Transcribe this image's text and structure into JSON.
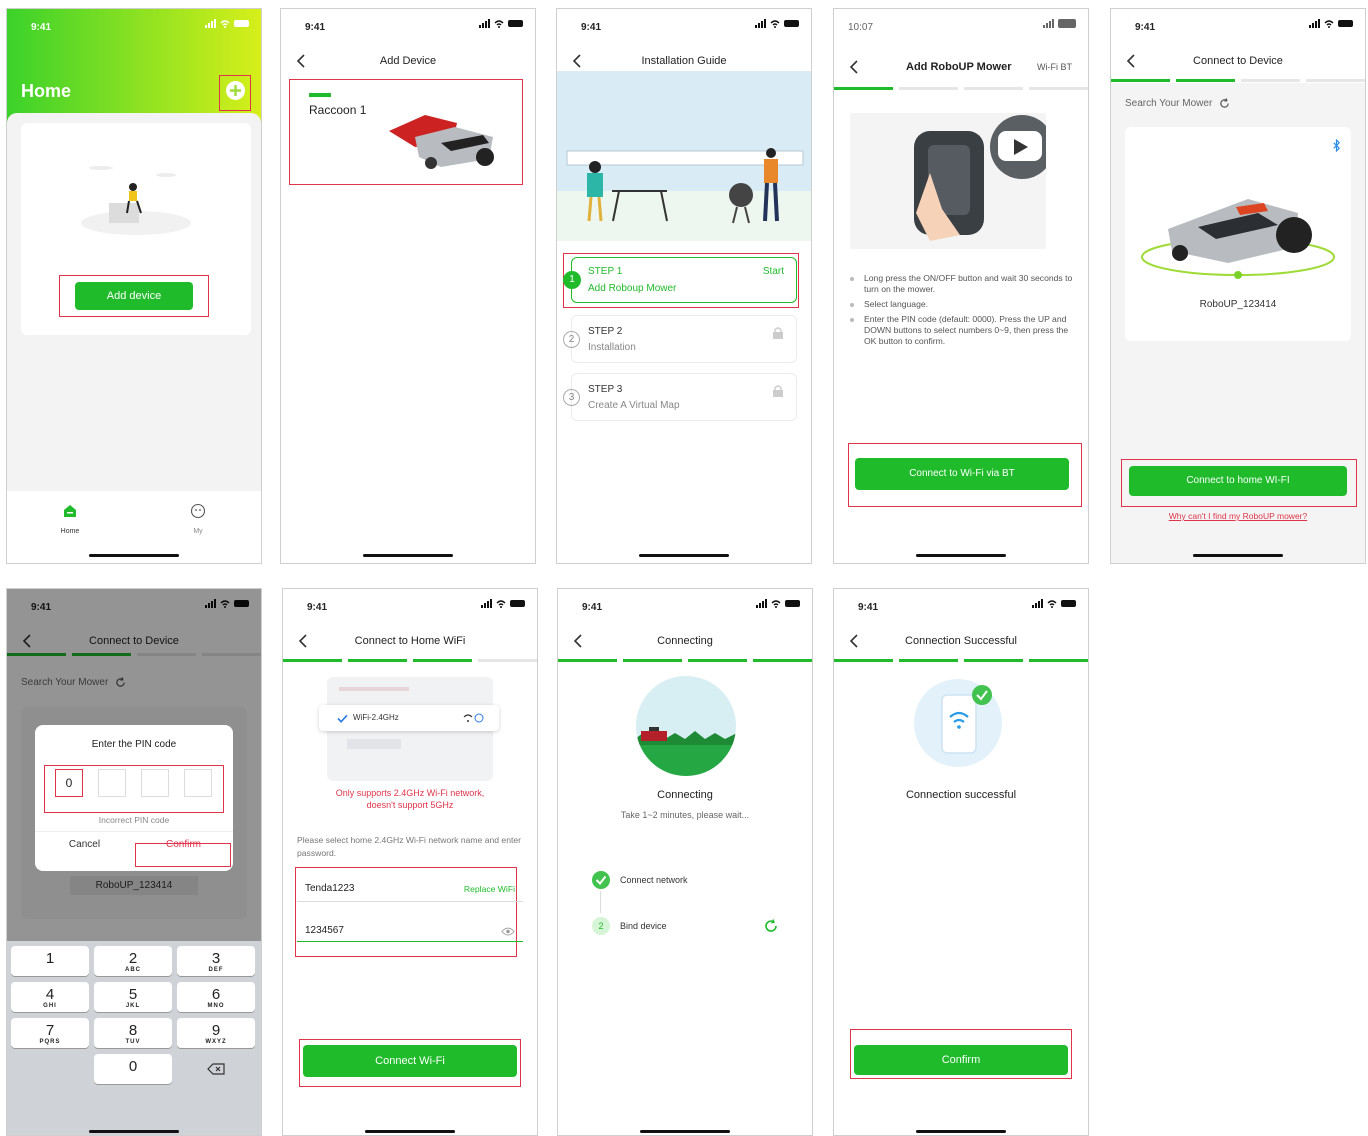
{
  "colors": {
    "accent": "#1fbb2b",
    "annotation": "#e0344a",
    "home_gradient_start": "#3bd22a",
    "home_gradient_end": "#d7ef1a",
    "link_red": "#e0344a"
  },
  "status_time": "9:41",
  "screen1": {
    "title": "Home",
    "add_button": "Add device",
    "tabs": [
      {
        "label": "Home",
        "icon": "home-icon"
      },
      {
        "label": "My",
        "icon": "robot-face-icon"
      }
    ]
  },
  "screen2": {
    "title": "Add Device",
    "device_name": "Raccoon 1"
  },
  "screen3": {
    "title": "Installation Guide",
    "steps": [
      {
        "number": "1",
        "label": "STEP 1",
        "desc": "Add Roboup Mower",
        "action": "Start"
      },
      {
        "number": "2",
        "label": "STEP 2",
        "desc": "Installation",
        "action": ""
      },
      {
        "number": "3",
        "label": "STEP 3",
        "desc": "Create A Virtual Map",
        "action": ""
      }
    ]
  },
  "screen4": {
    "status_time": "10:07",
    "title": "Add RoboUP Mower",
    "right_link": "Wi-Fi BT",
    "instructions": [
      "Long press the ON/OFF button and wait 30 seconds to turn on the mower.",
      "Select language.",
      "Enter the PIN code (default: 0000). Press the UP and DOWN buttons to select numbers 0~9, then press the OK button to confirm."
    ],
    "button": "Connect to Wi-Fi via BT"
  },
  "screen5": {
    "title": "Connect to Device",
    "search_label": "Search Your Mower",
    "device_name": "RoboUP_123414",
    "button": "Connect to home WI-FI",
    "help_link": "Why can't I find my RoboUP mower?"
  },
  "screen6": {
    "title": "Connect to Device",
    "search_label": "Search Your Mower",
    "dialog_title": "Enter the PIN code",
    "pin_digits": [
      "0",
      "",
      "",
      ""
    ],
    "error": "Incorrect PIN code",
    "cancel": "Cancel",
    "confirm": "Confirm",
    "device_name": "RoboUP_123414",
    "keys": [
      {
        "n": "1",
        "l": ""
      },
      {
        "n": "2",
        "l": "ABC"
      },
      {
        "n": "3",
        "l": "DEF"
      },
      {
        "n": "4",
        "l": "GHI"
      },
      {
        "n": "5",
        "l": "JKL"
      },
      {
        "n": "6",
        "l": "MNO"
      },
      {
        "n": "7",
        "l": "PQRS"
      },
      {
        "n": "8",
        "l": "TUV"
      },
      {
        "n": "9",
        "l": "WXYZ"
      },
      {
        "n": "0",
        "l": ""
      }
    ]
  },
  "screen7": {
    "title": "Connect to Home WiFi",
    "wifi_selected": "WiFi-2.4GHz",
    "warning": "Only supports 2.4GHz Wi-Fi network, doesn't support 5GHz",
    "hint": "Please select home 2.4GHz Wi-Fi network name and enter password.",
    "ssid": "Tenda1223",
    "replace": "Replace WiFi",
    "password": "1234567",
    "button": "Connect Wi-Fi"
  },
  "screen8": {
    "title": "Connecting",
    "heading": "Connecting",
    "sub": "Take 1~2 minutes, please wait...",
    "steps": [
      {
        "label": "Connect network",
        "num": ""
      },
      {
        "label": "Bind device",
        "num": "2"
      }
    ]
  },
  "screen9": {
    "title": "Connection Successful",
    "heading": "Connection successful",
    "button": "Confirm"
  }
}
